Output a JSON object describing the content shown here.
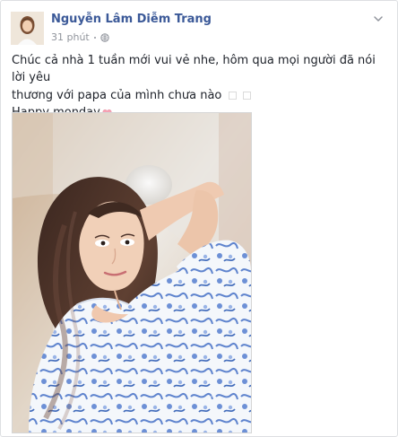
{
  "post": {
    "author": "Nguyễn Lâm Diễm Trang",
    "time": "31 phút",
    "caption_line_1": "Chúc cả nhà 1 tuần mới vui vẻ nhe, hôm qua mọi người đã nói lời yêu",
    "caption_line_2": "thương với papa của mình chưa nào",
    "caption_line_3": "Happy monday"
  },
  "icons": {
    "globe": "globe-icon",
    "options": "chevron-down-icon",
    "heart": "heart-icon"
  },
  "colors": {
    "link": "#3b5998",
    "text": "#1d2129",
    "muted": "#90949c",
    "heart": "#f6a1b3"
  }
}
